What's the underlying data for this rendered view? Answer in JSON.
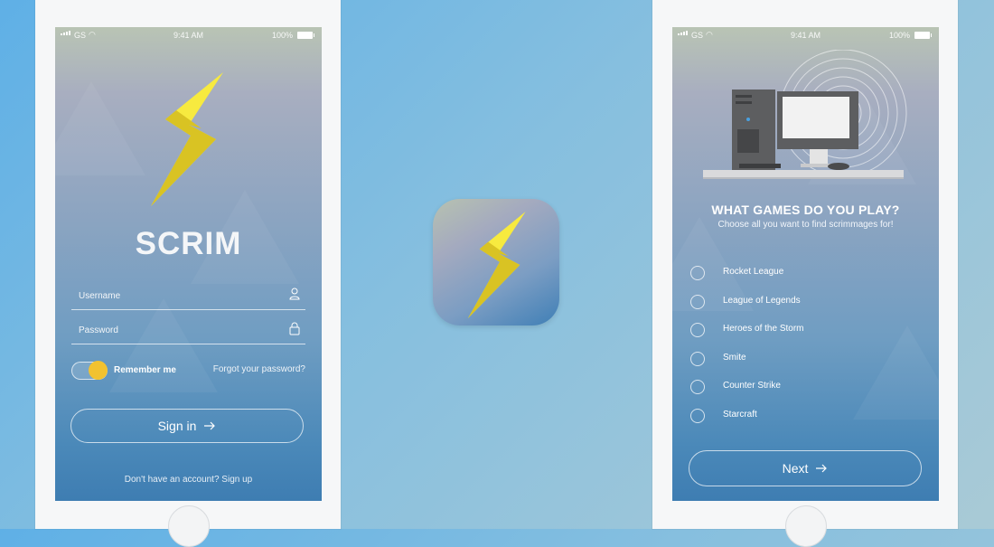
{
  "status_bar": {
    "carrier": "GS",
    "time": "9:41 AM",
    "battery": "100%"
  },
  "login": {
    "app_name": "SCRIM",
    "username_label": "Username",
    "password_label": "Password",
    "remember_label": "Remember me",
    "remember_checked": true,
    "forgot_label": "Forgot your password?",
    "signin_label": "Sign in",
    "signup_label": "Don't have an account? Sign up"
  },
  "onboarding": {
    "title": "WHAT GAMES DO YOU PLAY?",
    "subtitle": "Choose all you want to find scrimmages for!",
    "games": [
      {
        "name": "Rocket League",
        "selected": false
      },
      {
        "name": "League of Legends",
        "selected": false
      },
      {
        "name": "Heroes of the Storm",
        "selected": false
      },
      {
        "name": "Smite",
        "selected": false
      },
      {
        "name": "Counter Strike",
        "selected": false
      },
      {
        "name": "Starcraft",
        "selected": false
      }
    ],
    "next_label": "Next"
  },
  "icons": {
    "logo": "lightning-bolt-icon",
    "user": "user-icon",
    "lock": "lock-icon",
    "arrow": "arrow-right-icon",
    "illustration": "desktop-computer-icon"
  },
  "colors": {
    "bolt_yellow": "#f5e53a",
    "toggle_knob": "#f2c230",
    "background": "#7fbde2"
  }
}
